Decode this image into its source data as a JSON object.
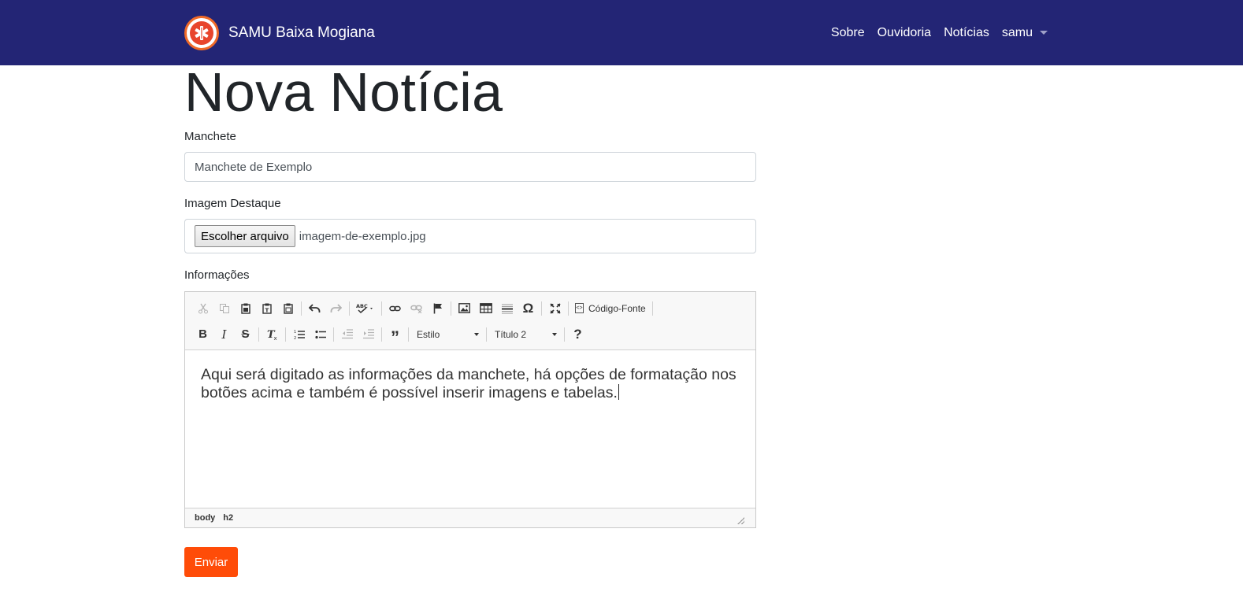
{
  "navbar": {
    "brand": "SAMU Baixa Mogiana",
    "links": [
      "Sobre",
      "Ouvidoria",
      "Notícias"
    ],
    "user": "samu",
    "colors": {
      "background": "#232575",
      "logo_ring": "#f06a28",
      "logo_fill": "#e8452c"
    }
  },
  "page": {
    "title": "Nova Notícia"
  },
  "form": {
    "headline": {
      "label": "Manchete",
      "value": "Manchete de Exemplo"
    },
    "image": {
      "label": "Imagem Destaque",
      "button": "Escolher arquivo",
      "filename": "imagem-de-exemplo.jpg"
    },
    "info": {
      "label": "Informações",
      "toolbar": {
        "source_label": "Código-Fonte",
        "style_combo": "Estilo",
        "format_combo": "Título 2"
      },
      "content": "Aqui será digitado as informações da manchete, há opções de formatação nos botões acima e também é possível inserir imagens e tabelas.",
      "path": [
        "body",
        "h2"
      ]
    },
    "submit": "Enviar",
    "submit_color": "#ff4c08"
  }
}
